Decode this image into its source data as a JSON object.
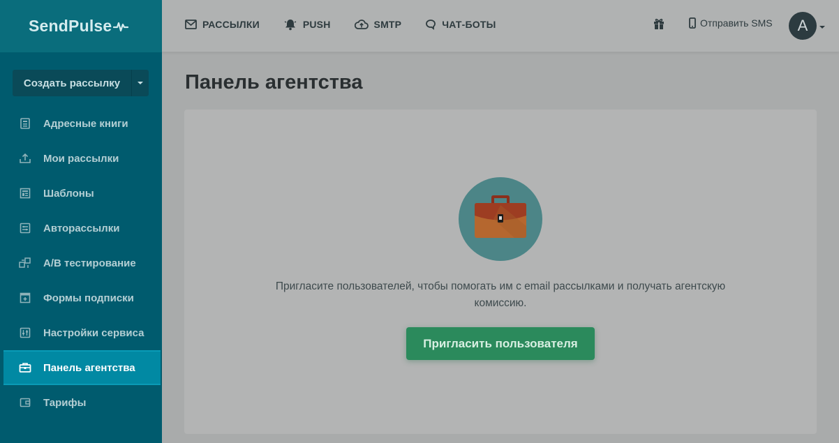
{
  "app": {
    "logo_text": "SendPulse"
  },
  "sidebar": {
    "create_button": "Создать рассылку",
    "items": [
      {
        "label": "Адресные книги",
        "icon": "address-book-icon",
        "active": false
      },
      {
        "label": "Мои рассылки",
        "icon": "upload-tray-icon",
        "active": false
      },
      {
        "label": "Шаблоны",
        "icon": "template-icon",
        "active": false
      },
      {
        "label": "Авторассылки",
        "icon": "automation-icon",
        "active": false
      },
      {
        "label": "A/B тестирование",
        "icon": "ab-test-icon",
        "active": false
      },
      {
        "label": "Формы подписки",
        "icon": "form-icon",
        "active": false
      },
      {
        "label": "Настройки сервиса",
        "icon": "settings-sliders-icon",
        "active": false
      },
      {
        "label": "Панель агентства",
        "icon": "briefcase-icon",
        "active": true
      },
      {
        "label": "Тарифы",
        "icon": "wallet-icon",
        "active": false
      }
    ]
  },
  "topbar": {
    "nav": [
      {
        "label": "РАССЫЛКИ",
        "icon": "envelope-icon"
      },
      {
        "label": "PUSH",
        "icon": "bell-icon"
      },
      {
        "label": "SMTP",
        "icon": "cloud-upload-icon"
      },
      {
        "label": "ЧАТ-БОТЫ",
        "icon": "chat-bubble-icon"
      }
    ],
    "gift_icon": "gift-icon",
    "sms_label": "Отправить SMS",
    "avatar_letter": "A"
  },
  "main": {
    "title": "Панель агентства",
    "invite_text": "Пригласите пользователей, чтобы помогать им с email рассылками и получать агентскую комиссию.",
    "invite_button": "Пригласить пользователя"
  },
  "colors": {
    "sidebar": "#005b6e",
    "sidebar_active": "#0189a3",
    "button_green": "#2b8a5c",
    "emblem": "#4c8587"
  }
}
